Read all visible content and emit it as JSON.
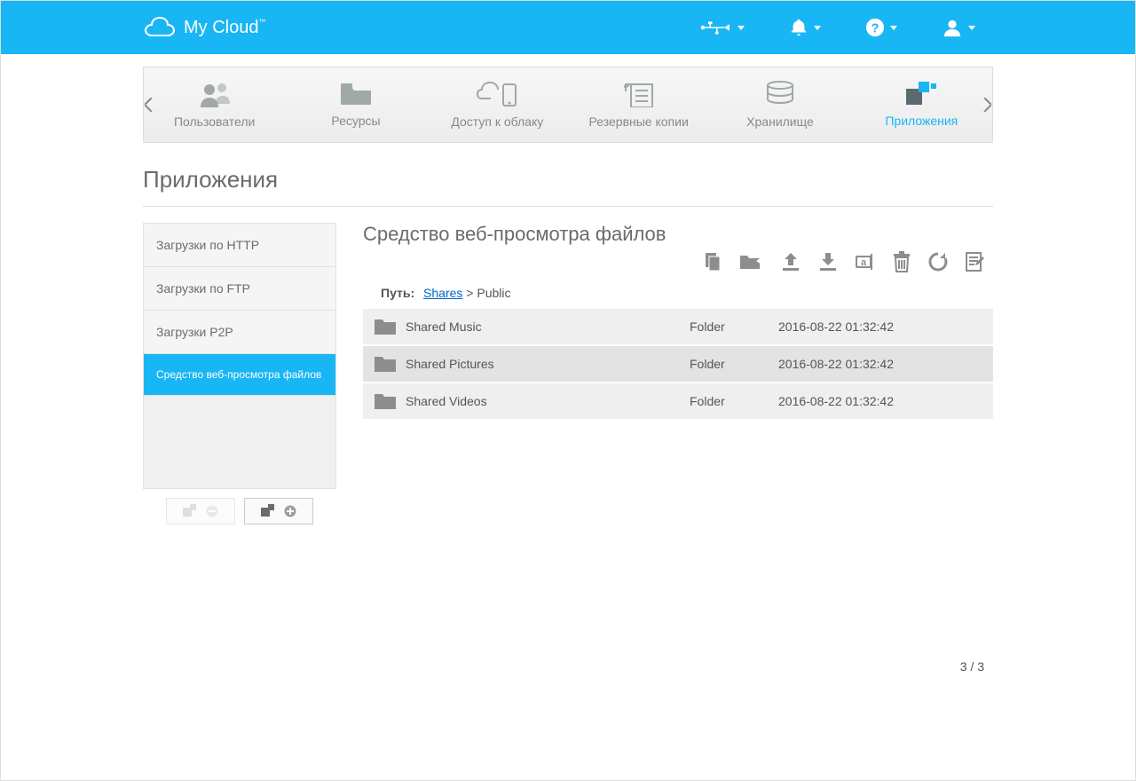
{
  "brand": {
    "name": "My Cloud"
  },
  "tabs": [
    {
      "label": "Пользователи"
    },
    {
      "label": "Ресурсы"
    },
    {
      "label": "Доступ к облаку"
    },
    {
      "label": "Резервные копии"
    },
    {
      "label": "Хранилище"
    },
    {
      "label": "Приложения"
    }
  ],
  "page_title": "Приложения",
  "sidebar": {
    "items": [
      {
        "label": "Загрузки по HTTP"
      },
      {
        "label": "Загрузки по FTP"
      },
      {
        "label": "Загрузки P2P"
      },
      {
        "label": "Средство веб-просмотра файлов"
      }
    ]
  },
  "content": {
    "title": "Средство веб-просмотра файлов",
    "breadcrumb": {
      "label": "Путь:",
      "root": "Shares",
      "sep": ">",
      "current": "Public"
    },
    "rows": [
      {
        "name": "Shared Music",
        "type": "Folder",
        "date": "2016-08-22 01:32:42"
      },
      {
        "name": "Shared Pictures",
        "type": "Folder",
        "date": "2016-08-22 01:32:42"
      },
      {
        "name": "Shared Videos",
        "type": "Folder",
        "date": "2016-08-22 01:32:42"
      }
    ],
    "pager": "3 / 3"
  }
}
